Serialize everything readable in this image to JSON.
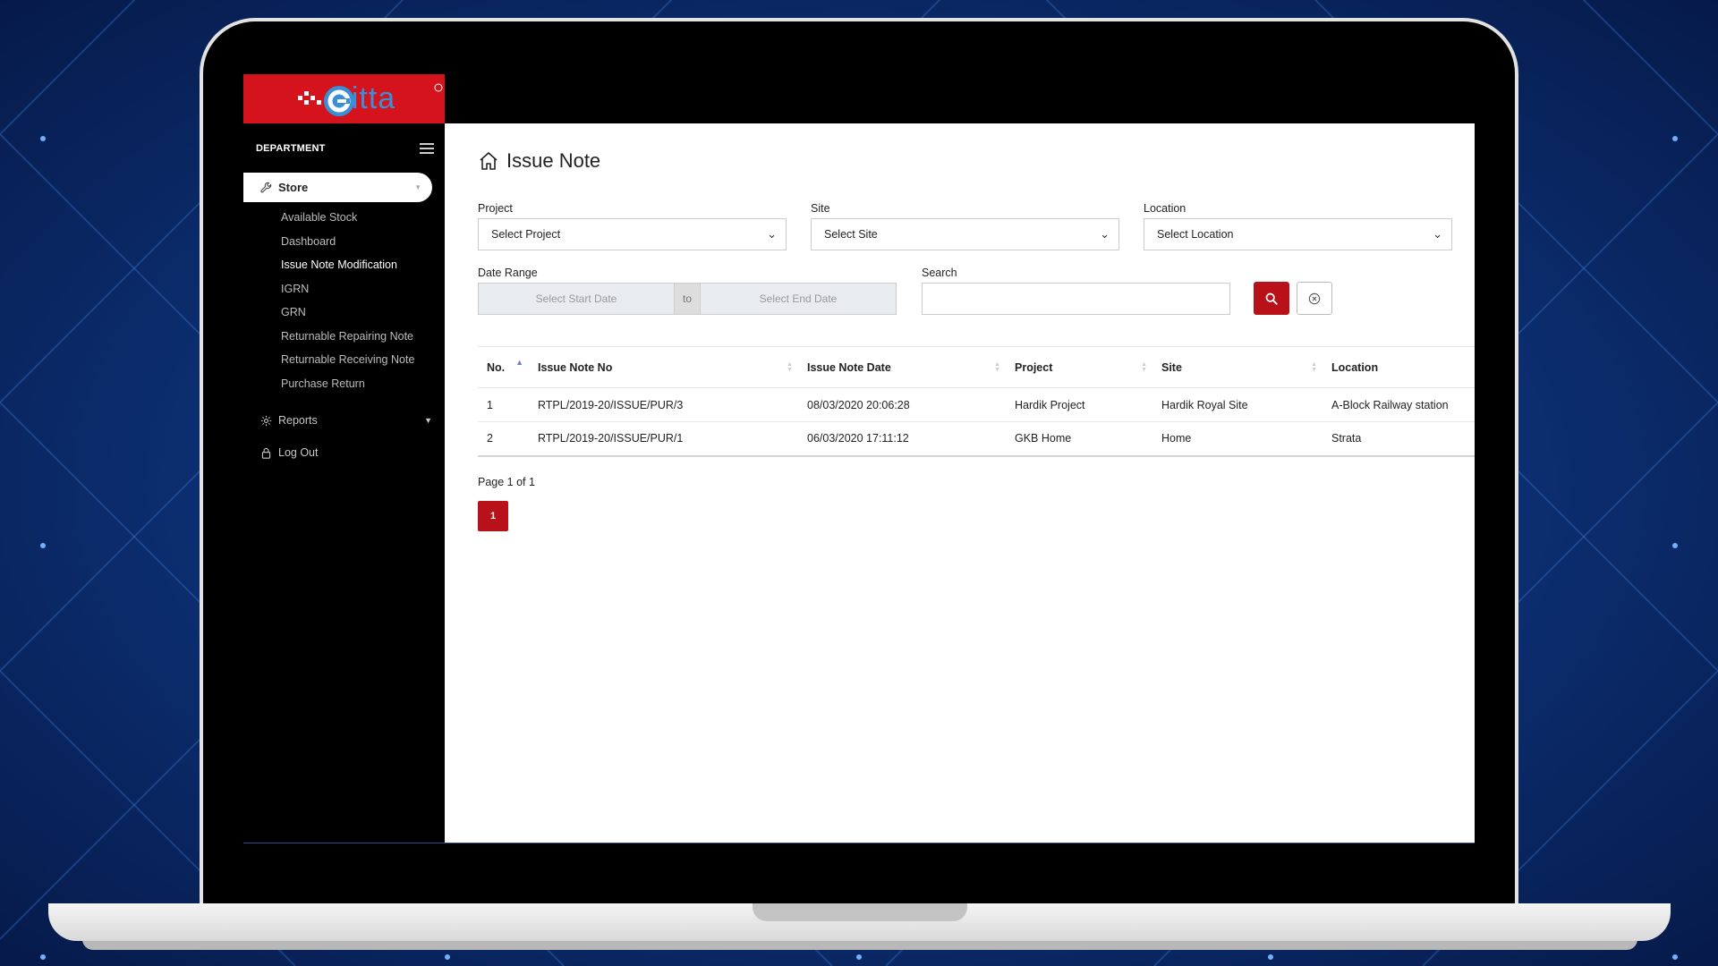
{
  "sidebar": {
    "logo_text": "itta",
    "department_label": "DEPARTMENT",
    "store": {
      "label": "Store"
    },
    "submenu": [
      {
        "label": "Available Stock",
        "active": false
      },
      {
        "label": "Dashboard",
        "active": false
      },
      {
        "label": "Issue Note Modification",
        "active": true
      },
      {
        "label": "IGRN",
        "active": false
      },
      {
        "label": "GRN",
        "active": false
      },
      {
        "label": "Returnable Repairing Note",
        "active": false
      },
      {
        "label": "Returnable Receiving Note",
        "active": false
      },
      {
        "label": "Purchase Return",
        "active": false
      }
    ],
    "reports_label": "Reports",
    "logout_label": "Log Out"
  },
  "page": {
    "title": "Issue Note"
  },
  "filters": {
    "project_label": "Project",
    "project_value": "Select Project",
    "site_label": "Site",
    "site_value": "Select Site",
    "location_label": "Location",
    "location_value": "Select Location",
    "date_range_label": "Date Range",
    "start_placeholder": "Select Start Date",
    "separator": "to",
    "end_placeholder": "Select End Date",
    "search_label": "Search",
    "search_value": ""
  },
  "table": {
    "columns": [
      "No.",
      "Issue Note No",
      "Issue Note Date",
      "Project",
      "Site",
      "Location"
    ],
    "rows": [
      [
        "1",
        "RTPL/2019-20/ISSUE/PUR/3",
        "08/03/2020 20:06:28",
        "Hardik Project",
        "Hardik Royal Site",
        "A-Block Railway station"
      ],
      [
        "2",
        "RTPL/2019-20/ISSUE/PUR/1",
        "06/03/2020 17:11:12",
        "GKB Home",
        "Home",
        "Strata"
      ]
    ]
  },
  "pagination": {
    "info": "Page 1 of 1",
    "current": "1"
  },
  "colors": {
    "brand_red": "#d4131c",
    "button_red": "#b8111a",
    "sidebar_bg": "#000000",
    "content_bg": "#ffffff"
  }
}
